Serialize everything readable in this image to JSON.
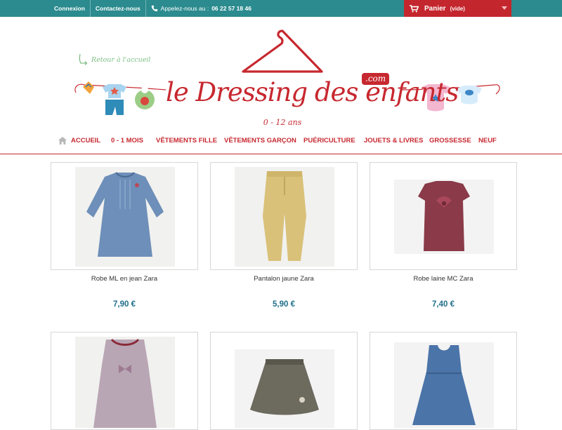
{
  "topbar": {
    "login": "Connexion",
    "contact": "Contactez-nous",
    "phone_label": "Appelez-nous au :",
    "phone_number": "06 22 57 18 46",
    "cart_label": "Panier",
    "cart_status": "(vide)"
  },
  "header": {
    "back_link": "Retour à l'accueil",
    "logo_main": "le Dressing des enfants",
    "logo_domain": ".com",
    "logo_age": "0 - 12 ans"
  },
  "nav": {
    "items": [
      "ACCUEIL",
      "0 - 1 MOIS",
      "VÊTEMENTS FILLE",
      "VÊTEMENTS GARÇON",
      "PUÉRICULTURE",
      "JOUETS & LIVRES",
      "GROSSESSE",
      "NEUF"
    ]
  },
  "products": [
    {
      "name": "Robe ML en jean Zara",
      "price": "7,90 €"
    },
    {
      "name": "Pantalon jaune Zara",
      "price": "5,90 €"
    },
    {
      "name": "Robe laine MC Zara",
      "price": "7,40 €"
    },
    {
      "name": "",
      "price": ""
    },
    {
      "name": "",
      "price": ""
    },
    {
      "name": "",
      "price": ""
    }
  ],
  "colors": {
    "teal": "#2b8b8e",
    "brand_red": "#c7282f",
    "price_blue": "#1f6f8b"
  },
  "icons": [
    "phone-icon",
    "cart-icon",
    "home-icon",
    "hanger-icon",
    "arrow-back-icon"
  ]
}
